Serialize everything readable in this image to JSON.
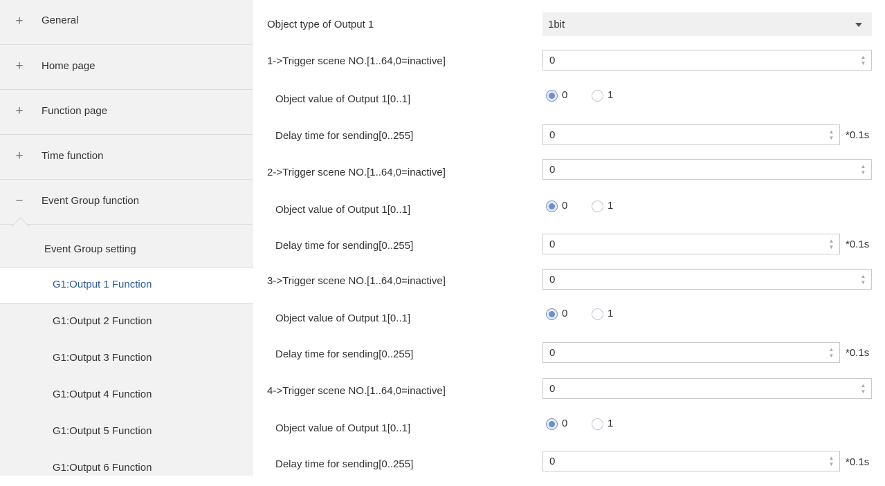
{
  "sidebar": {
    "groups": [
      {
        "symbol": "+",
        "label": "General"
      },
      {
        "symbol": "+",
        "label": "Home page"
      },
      {
        "symbol": "+",
        "label": "Function page"
      },
      {
        "symbol": "+",
        "label": "Time function"
      },
      {
        "symbol": "−",
        "label": "Event Group function"
      }
    ],
    "setting_label": "Event Group setting",
    "outputs": [
      {
        "label": "G1:Output 1 Function",
        "active": true
      },
      {
        "label": "G1:Output 2 Function",
        "active": false
      },
      {
        "label": "G1:Output 3 Function",
        "active": false
      },
      {
        "label": "G1:Output 4 Function",
        "active": false
      },
      {
        "label": "G1:Output 5 Function",
        "active": false
      },
      {
        "label": "G1:Output 6 Function",
        "active": false
      }
    ]
  },
  "main": {
    "object_type": {
      "label": "Object type of Output 1",
      "value": "1bit"
    },
    "scenes": [
      {
        "trigger_label": "1->Trigger scene NO.[1..64,0=inactive]",
        "trigger_value": "0",
        "object_label": "Object value of Output 1[0..1]",
        "radio_options": [
          "0",
          "1"
        ],
        "selected": "0",
        "delay_label": "Delay time for sending[0..255]",
        "delay_value": "0",
        "delay_unit": "*0.1s"
      },
      {
        "trigger_label": "2->Trigger scene NO.[1..64,0=inactive]",
        "trigger_value": "0",
        "object_label": "Object value of Output 1[0..1]",
        "radio_options": [
          "0",
          "1"
        ],
        "selected": "0",
        "delay_label": "Delay time for sending[0..255]",
        "delay_value": "0",
        "delay_unit": "*0.1s"
      },
      {
        "trigger_label": "3->Trigger scene NO.[1..64,0=inactive]",
        "trigger_value": "0",
        "object_label": "Object value of Output 1[0..1]",
        "radio_options": [
          "0",
          "1"
        ],
        "selected": "0",
        "delay_label": "Delay time for sending[0..255]",
        "delay_value": "0",
        "delay_unit": "*0.1s"
      },
      {
        "trigger_label": "4->Trigger scene NO.[1..64,0=inactive]",
        "trigger_value": "0",
        "object_label": "Object value of Output 1[0..1]",
        "radio_options": [
          "0",
          "1"
        ],
        "selected": "0",
        "delay_label": "Delay time for sending[0..255]",
        "delay_value": "0",
        "delay_unit": "*0.1s"
      }
    ]
  },
  "colors": {
    "sidebar_bg": "#f2f2f2",
    "active_text": "#2a5a9c",
    "radio_checked": "#6f8fc8"
  }
}
